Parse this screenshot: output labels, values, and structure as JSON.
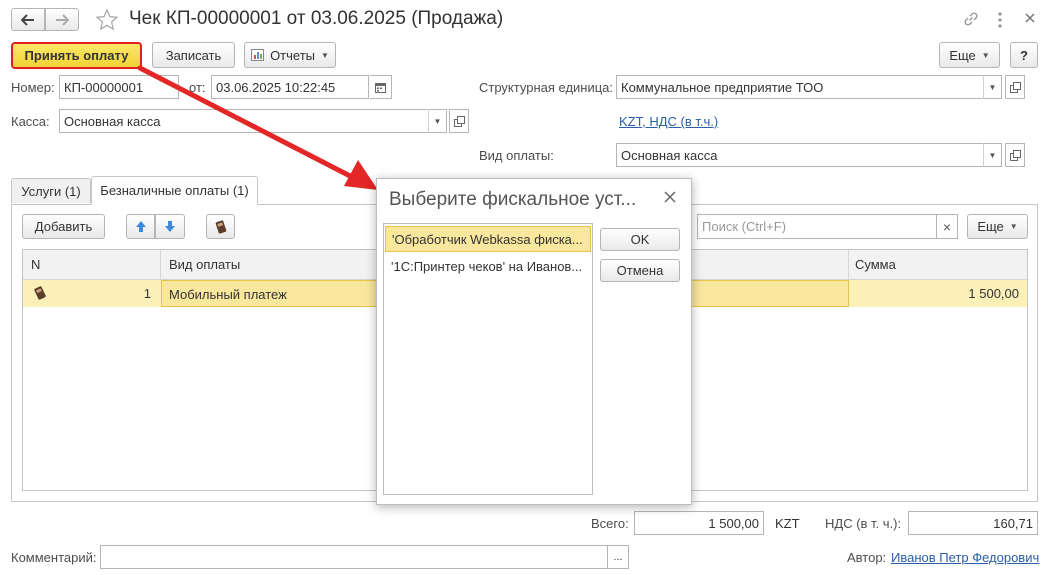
{
  "window": {
    "title": "Чек КП-00000001 от 03.06.2025 (Продажа)"
  },
  "toolbar": {
    "accept_payment": "Принять оплату",
    "save": "Записать",
    "reports": "Отчеты",
    "more": "Еще",
    "help": "?"
  },
  "form": {
    "number_label": "Номер:",
    "number_value": "КП-00000001",
    "date_label": "от:",
    "date_value": "03.06.2025 10:22:45",
    "unit_label": "Структурная единица:",
    "unit_value": "Коммунальное предприятие ТОО",
    "cash_label": "Касса:",
    "cash_value": "Основная касса",
    "tax_link": "KZT, НДС (в т.ч.)",
    "payment_type_label": "Вид оплаты:",
    "payment_type_value": "Основная касса"
  },
  "tabs": [
    {
      "label": "Услуги (1)"
    },
    {
      "label": "Безналичные оплаты (1)"
    }
  ],
  "table_toolbar": {
    "add": "Добавить",
    "search_placeholder": "Поиск (Ctrl+F)",
    "clear": "×",
    "more": "Еще"
  },
  "table": {
    "columns": {
      "n": "N",
      "type": "Вид оплаты",
      "sum": "Сумма"
    },
    "rows": [
      {
        "n": "1",
        "type": "Мобильный платеж",
        "sum": "1 500,00"
      }
    ]
  },
  "totals": {
    "total_label": "Всего:",
    "total_value": "1 500,00",
    "currency": "KZT",
    "vat_label": "НДС (в т. ч.):",
    "vat_value": "160,71"
  },
  "footer": {
    "comment_label": "Комментарий:",
    "comment_value": "",
    "comment_btn": "...",
    "author_label": "Автор:",
    "author_value": "Иванов Петр Федорович"
  },
  "dialog": {
    "title": "Выберите фискальное уст...",
    "close": "×",
    "items": [
      "'Обработчик Webkassa фиска...",
      "'1С:Принтер чеков' на Иванов..."
    ],
    "ok": "OK",
    "cancel": "Отмена"
  },
  "colors": {
    "accent_yellow": "#f8e24c",
    "highlight_border": "#e02020",
    "row_selected": "#fbf0b8",
    "link_blue": "#2a5ea8",
    "arrow_red": "#e32626"
  }
}
